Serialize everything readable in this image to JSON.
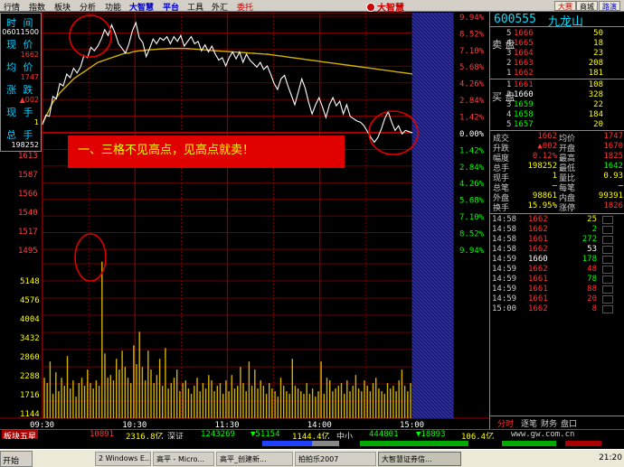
{
  "menu": {
    "items": [
      "行情",
      "指数",
      "板块",
      "分析",
      "功能",
      "大智慧",
      "平台",
      "工具",
      "外汇",
      "委托"
    ],
    "brand": "大智慧",
    "top_buttons": [
      "大赛",
      "商城",
      "路演"
    ]
  },
  "left_info": {
    "time_label": "时 间",
    "time_value": "06011500",
    "price_label": "现 价",
    "price_value": "1662",
    "avg_label": "均 价",
    "avg_value": "1747",
    "change_label": "涨 跌",
    "change_value": "▲002",
    "hand_label": "现 手",
    "hand_value": "1",
    "total_label": "总 手",
    "total_value": "198252",
    "close_marker": "1662"
  },
  "chart": {
    "price_ticks_left": [
      "1613",
      "1587",
      "1566",
      "1540",
      "1517",
      "1495"
    ],
    "vol_ticks_left": [
      "5148",
      "4576",
      "4004",
      "3432",
      "2860",
      "2288",
      "1716",
      "1144",
      "572"
    ],
    "pct_ticks_up": [
      "9.94%",
      "8.52%",
      "7.10%",
      "5.68%",
      "4.26%",
      "2.84%",
      "1.42%",
      "0.00%"
    ],
    "pct_ticks_down": [
      "1.42%",
      "2.84%",
      "4.26%",
      "5.68%",
      "7.10%",
      "8.52%",
      "9.94%"
    ],
    "time_ticks": [
      "09:30",
      "10:30",
      "11:30",
      "14:00",
      "15:00"
    ],
    "annotation": "一、三格不见高点，见高点就卖！",
    "price_line": [
      0.7,
      1.5,
      1.4,
      3.1,
      2.9,
      4.2,
      4.0,
      5.0,
      4.7,
      5.5,
      5.1,
      5.6,
      6.6,
      6.4,
      7.3,
      7.0,
      7.4,
      8.0,
      8.8,
      8.3,
      9.2,
      8.5,
      7.6,
      7.2,
      6.8,
      7.6,
      8.7,
      9.4,
      8.1,
      7.7,
      6.5,
      7.2,
      8.0,
      7.6,
      8.1,
      7.9,
      8.2,
      7.6,
      8.2,
      7.8,
      8.3,
      7.4,
      7.8,
      8.2,
      7.6,
      7.8,
      7.0,
      7.5,
      6.9,
      7.4,
      6.7,
      6.2,
      6.4,
      5.7,
      6.4,
      6.9,
      6.3,
      6.9,
      6.0,
      6.7,
      6.2,
      5.9,
      5.6,
      6.0,
      5.4,
      5.7,
      5.0,
      4.2,
      3.7,
      4.6,
      4.9,
      4.0,
      3.2,
      2.4,
      3.5,
      4.6,
      3.8,
      2.6,
      1.6,
      2.4,
      3.0,
      2.2,
      1.3,
      2.4,
      3.0,
      2.3,
      2.7,
      1.6,
      2.4,
      1.4,
      1.2,
      1.0,
      0.9,
      0.6,
      0.1,
      -0.4,
      -0.8,
      -0.4,
      0.3,
      1.2,
      1.8,
      0.9,
      0.2,
      0.6,
      -0.1,
      0.2,
      0.1,
      0.0
    ],
    "avg_line": [
      0.8,
      1.4,
      2.0,
      2.6,
      3.0,
      3.4,
      3.7,
      4.0,
      4.3,
      4.6,
      4.8,
      5.0,
      5.2,
      5.4,
      5.6,
      5.8,
      6.0,
      6.1,
      6.2,
      6.3,
      6.4,
      6.5,
      6.6,
      6.7,
      6.8,
      6.8,
      6.9,
      6.95,
      7.0,
      7.0,
      7.05,
      7.1,
      7.1,
      7.12,
      7.15,
      7.15,
      7.18,
      7.2,
      7.2,
      7.2,
      7.2,
      7.2,
      7.18,
      7.16,
      7.14,
      7.12,
      7.1,
      7.08,
      7.05,
      7.02,
      7.0,
      6.98,
      6.96,
      6.94,
      6.92,
      6.9,
      6.88,
      6.86,
      6.84,
      6.82,
      6.8,
      6.78,
      6.76,
      6.74,
      6.72,
      6.7,
      6.66,
      6.62,
      6.58,
      6.54,
      6.5,
      6.46,
      6.42,
      6.38,
      6.34,
      6.3,
      6.26,
      6.22,
      6.18,
      6.14,
      6.1,
      6.06,
      6.02,
      5.98,
      5.94,
      5.9,
      5.86,
      5.82,
      5.78,
      5.74,
      5.7,
      5.66,
      5.62,
      5.58,
      5.54,
      5.5,
      5.46,
      5.42,
      5.38,
      5.34,
      5.3,
      5.26,
      5.22,
      5.18,
      5.14,
      5.1,
      5.06,
      5.02
    ],
    "volume": [
      1500,
      1300,
      2100,
      900,
      1700,
      1000,
      1500,
      1200,
      2300,
      1100,
      1400,
      800,
      1300,
      1500,
      1200,
      1800,
      1300,
      1100,
      1400,
      1200,
      5800,
      2400,
      1500,
      1600,
      1400,
      2200,
      1800,
      2500,
      1900,
      1500,
      1300,
      2700,
      2000,
      3200,
      1900,
      1400,
      2500,
      1800,
      1300,
      1600,
      2200,
      1200,
      2600,
      1100,
      1300,
      1500,
      1800,
      1000,
      1300,
      1400,
      1100,
      900,
      1200,
      1500,
      1000,
      1300,
      1100,
      1600,
      1400,
      1000,
      1200,
      1300,
      900,
      1400,
      1000,
      1600,
      1100,
      1200,
      1900,
      1300,
      1000,
      2100,
      1200,
      1800,
      1100,
      1400,
      1200,
      900,
      1300,
      1100,
      1000,
      800,
      1500,
      1200,
      1000,
      900,
      2200,
      1200,
      1100,
      1000,
      900,
      1300,
      900,
      1100,
      800,
      1000,
      2100,
      900,
      1500,
      1400,
      1000,
      1100,
      1200,
      1300,
      900,
      1400,
      1000,
      1200,
      1600,
      1100,
      1000,
      1400,
      1200,
      1000,
      1300,
      1500,
      1100,
      1000,
      900,
      1300,
      1100,
      1200,
      1000,
      1400,
      1800,
      1200,
      1000,
      1300
    ]
  },
  "orderbook": {
    "code": "600555",
    "name": "九龙山",
    "sell_label": "卖 盘",
    "buy_label": "买 盘",
    "asks": [
      {
        "lv": "5",
        "price": "1666",
        "vol": "50"
      },
      {
        "lv": "4",
        "price": "1665",
        "vol": "18"
      },
      {
        "lv": "3",
        "price": "1664",
        "vol": "23"
      },
      {
        "lv": "2",
        "price": "1663",
        "vol": "208"
      },
      {
        "lv": "1",
        "price": "1662",
        "vol": "181"
      }
    ],
    "bids": [
      {
        "lv": "1",
        "price": "1661",
        "vol": "108"
      },
      {
        "lv": "2",
        "price": "1660",
        "vol": "328"
      },
      {
        "lv": "3",
        "price": "1659",
        "vol": "22"
      },
      {
        "lv": "4",
        "price": "1658",
        "vol": "184"
      },
      {
        "lv": "5",
        "price": "1657",
        "vol": "20"
      }
    ]
  },
  "stats": [
    {
      "k1": "成交",
      "v1": "1662",
      "k2": "均价",
      "v2": "1747"
    },
    {
      "k1": "升跌",
      "v1": "▲002",
      "k2": "开盘",
      "v2": "1670"
    },
    {
      "k1": "幅度",
      "v1": "0.12%",
      "k2": "最高",
      "v2": "1825"
    },
    {
      "k1": "总手",
      "v1": "198252",
      "k2": "最低",
      "v2": "1642"
    },
    {
      "k1": "现手",
      "v1": "1",
      "k2": "量比",
      "v2": "0.93"
    },
    {
      "k1": "总笔",
      "v1": "—",
      "k2": "每笔",
      "v2": "—"
    },
    {
      "k1": "外盘",
      "v1": "98861",
      "k2": "内盘",
      "v2": "99391"
    },
    {
      "k1": "换手",
      "v1": "15.95%",
      "k2": "涨停",
      "v2": "1826"
    }
  ],
  "trades": [
    {
      "t": "14:58",
      "p": "1662",
      "v": "25",
      "c": "y"
    },
    {
      "t": "14:58",
      "p": "1662",
      "v": "2",
      "c": "g"
    },
    {
      "t": "14:58",
      "p": "1661",
      "v": "272",
      "c": "g"
    },
    {
      "t": "14:58",
      "p": "1662",
      "v": "53",
      "c": "w"
    },
    {
      "t": "14:59",
      "p": "1660",
      "v": "178",
      "c": "g"
    },
    {
      "t": "14:59",
      "p": "1662",
      "v": "48",
      "c": "r"
    },
    {
      "t": "14:59",
      "p": "1661",
      "v": "78",
      "c": "g"
    },
    {
      "t": "14:59",
      "p": "1661",
      "v": "88",
      "c": "r"
    },
    {
      "t": "14:59",
      "p": "1661",
      "v": "20",
      "c": "r"
    },
    {
      "t": "15:00",
      "p": "1662",
      "v": "8",
      "c": "r"
    }
  ],
  "right_tabs": [
    "分时",
    "逐笔",
    "财务",
    "盘口"
  ],
  "index_bar": {
    "seg1": "板块五星",
    "seg2": "10891",
    "seg3": "2316.8亿",
    "seg4": "深证",
    "seg5": "1243269",
    "seg6": "▼51154",
    "seg7": "1144.4亿",
    "seg8": "中小",
    "seg9": "444801",
    "seg10": "▼18893",
    "seg11": "106.4亿",
    "seg12": "www.gw.com.cn"
  },
  "taskbar": {
    "start": "开始",
    "items": [
      "2 Windows E...",
      "高平 - Micro...",
      "高平_创建新...",
      "拍拍乐2007",
      "大智慧证券信..."
    ],
    "clock": "21:20"
  }
}
